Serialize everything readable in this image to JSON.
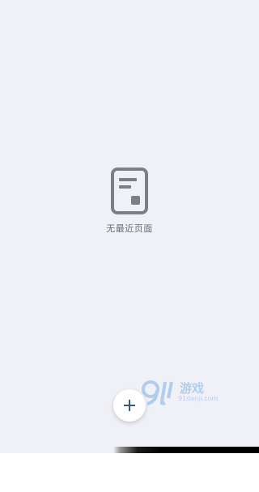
{
  "empty_state": {
    "icon": "document-icon",
    "message": "无最近页面"
  },
  "fab": {
    "icon": "plus-icon",
    "accent_color": "#3b5a7a"
  },
  "watermark": {
    "logo_text": "游戏",
    "url": "91danji.com"
  },
  "colors": {
    "background": "#f0f1f6",
    "icon_gray": "#7d7f84"
  }
}
